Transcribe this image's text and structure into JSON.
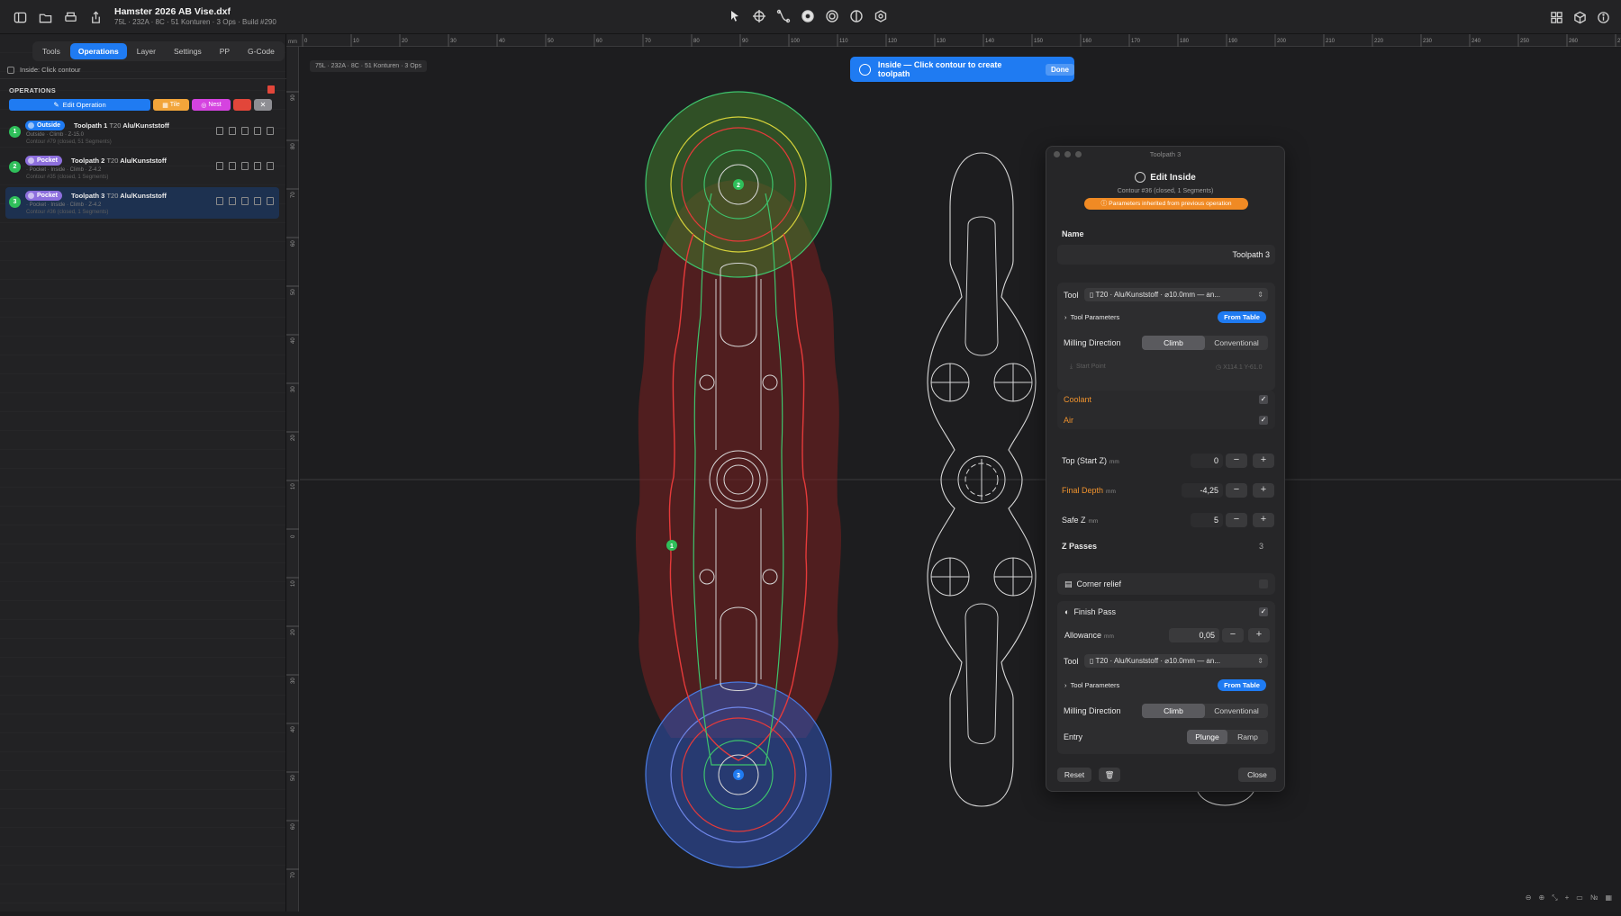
{
  "document": {
    "title": "Hamster 2026 AB Vise.dxf",
    "subtitle": "75L · 232A · 8C · 51 Konturen · 3 Ops · Build #290"
  },
  "sidebar": {
    "tabs": [
      "Tools",
      "Operations",
      "Layer",
      "Settings",
      "PP",
      "G-Code"
    ],
    "active_tab": "Operations",
    "hint": "Inside: Click contour",
    "operations_label": "OPERATIONS",
    "edit_operation_label": "Edit Operation",
    "tile_label": "Tile",
    "nest_label": "Nest",
    "operations": [
      {
        "num": "1",
        "type": "Outside",
        "name": "Toolpath 1",
        "tool": "T20",
        "material": "Alu/Kunststoff",
        "sub": "Outside · Climb · Z-15.0",
        "sub2": "Contour #79 (closed, 51 Segments)"
      },
      {
        "num": "2",
        "type": "Pocket",
        "name": "Toolpath 2",
        "tool": "T20",
        "material": "Alu/Kunststoff",
        "sub": "· Pocket · Inside · Climb · Z-4.2",
        "sub2": "Contour #35 (closed, 1 Segments)"
      },
      {
        "num": "3",
        "type": "Pocket",
        "name": "Toolpath 3",
        "tool": "T20",
        "material": "Alu/Kunststoff",
        "sub": "· Pocket · Inside · Climb · Z-4.2",
        "sub2": "Contour #36 (closed, 1 Segments)"
      }
    ]
  },
  "canvas": {
    "info": "75L · 232A · 8C · 51 Konturen · 3 Ops",
    "toast": "Inside — Click contour to create toolpath",
    "toast_done": "Done",
    "ruler_unit": "mm",
    "ruler_top": [
      "0",
      "10",
      "20",
      "30",
      "40",
      "50",
      "60",
      "70",
      "80",
      "90",
      "100",
      "110",
      "120",
      "130",
      "140",
      "150",
      "160",
      "170",
      "180",
      "190",
      "200",
      "210",
      "220",
      "230",
      "240",
      "250",
      "260",
      "270",
      "280"
    ],
    "ruler_left": [
      "90",
      "80",
      "70",
      "60",
      "50",
      "40",
      "30",
      "20",
      "10",
      "0",
      "10",
      "20",
      "30",
      "40",
      "50",
      "60",
      "70",
      "80"
    ],
    "markers": [
      "1",
      "2",
      "3"
    ]
  },
  "panel": {
    "window_title": "Toolpath 3",
    "heading": "Edit Inside",
    "contour_info": "Contour #36 (closed, 1 Segments)",
    "inherited": "Parameters inherited from previous operation",
    "name_label": "Name",
    "name_value": "Toolpath 3",
    "tool_label": "Tool",
    "tool_value": "T20 · Alu/Kunststoff · ⌀10.0mm — an...",
    "tool_params_label": "Tool Parameters",
    "from_table_label": "From Table",
    "milling_direction_label": "Milling Direction",
    "climb_label": "Climb",
    "conventional_label": "Conventional",
    "start_point_label": "Start Point",
    "start_point_value": "X114.1 Y-61.0",
    "coolant_label": "Coolant",
    "air_label": "Air",
    "top_label": "Top (Start Z)",
    "top_value": "0",
    "final_depth_label": "Final Depth",
    "final_depth_value": "-4,25",
    "safe_z_label": "Safe Z",
    "safe_z_value": "5",
    "unit_mm": "mm",
    "z_passes_label": "Z Passes",
    "z_passes_value": "3",
    "corner_relief_label": "Corner relief",
    "finish_pass_label": "Finish Pass",
    "allowance_label": "Allowance",
    "allowance_value": "0,05",
    "entry_label": "Entry",
    "plunge_label": "Plunge",
    "ramp_label": "Ramp",
    "reset_label": "Reset",
    "close_label": "Close"
  },
  "colors": {
    "accent": "#1f7bf2",
    "outside_path": "#e63a3a",
    "green_path": "#3ec46d",
    "yellow_path": "#d6d23a",
    "blue_path": "#4a7be0",
    "warning": "#f08a24"
  }
}
